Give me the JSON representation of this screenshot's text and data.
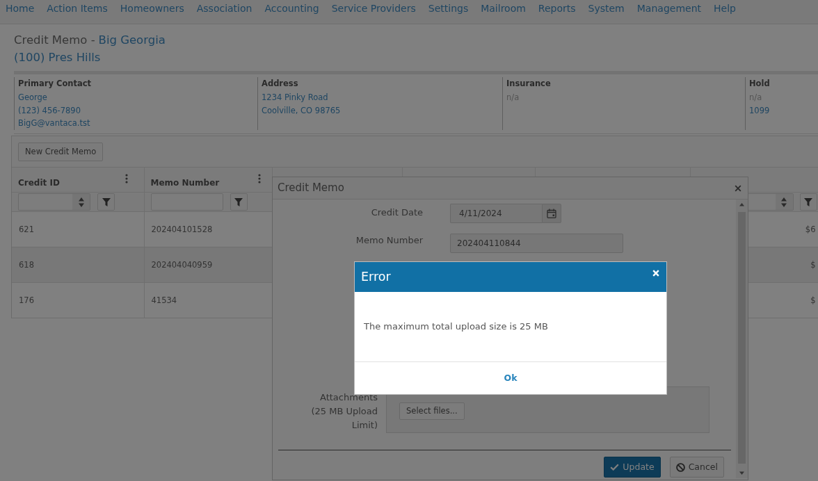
{
  "nav_items": [
    "Home",
    "Action Items",
    "Homeowners",
    "Association",
    "Accounting",
    "Service Providers",
    "Settings",
    "Mailroom",
    "Reports",
    "System",
    "Management",
    "Help"
  ],
  "page_header": {
    "title": "Credit Memo -",
    "homeowner": "Big Georgia",
    "property": "(100) Pres Hills"
  },
  "info_panel": [
    {
      "heading": "Primary Contact",
      "lines": [
        {
          "text": "George",
          "kind": "link"
        },
        {
          "text": "(123) 456-7890",
          "kind": "link"
        },
        {
          "text": "BigG@vantaca.tst",
          "kind": "link"
        }
      ]
    },
    {
      "heading": "Address",
      "lines": [
        {
          "text": "1234 Pinky Road",
          "kind": "link"
        },
        {
          "text": "Coolville, CO 98765",
          "kind": "link"
        }
      ]
    },
    {
      "heading": "Insurance",
      "lines": [
        {
          "text": "n/a",
          "kind": "muted"
        }
      ]
    },
    {
      "heading": "Hold",
      "lines": [
        {
          "text": "n/a",
          "kind": "muted"
        },
        {
          "text": "1099",
          "kind": "link"
        }
      ]
    }
  ],
  "toolbar": {
    "buttons": [
      "New Credit Memo"
    ]
  },
  "grid": {
    "columns": [
      {
        "label": "Credit ID",
        "kind": "numeric"
      },
      {
        "label": "Memo Number",
        "kind": "text"
      }
    ],
    "column_6": {
      "kind": "numeric"
    },
    "rows": [
      {
        "cells": [
          "621",
          "202404101528"
        ],
        "column_6": "$6"
      },
      {
        "cells": [
          "618",
          "202404040959"
        ],
        "column_6": "$"
      },
      {
        "cells": [
          "176",
          "41534"
        ],
        "column_6": "$"
      }
    ]
  },
  "credit_memo_dialog": {
    "title": "Credit Memo",
    "fields": [
      {
        "kind": "date",
        "label": "Credit Date",
        "value": "4/11/2024"
      },
      {
        "kind": "text",
        "label": "Memo Number",
        "value": "202404110844"
      },
      {
        "kind": "upload",
        "label": "Attachments (25 MB Upload Limit)",
        "button": "Select files..."
      }
    ],
    "buttons": [
      {
        "kind": "primary",
        "label": "Update"
      },
      {
        "kind": "cancel",
        "label": "Cancel"
      }
    ]
  },
  "error_dialog": {
    "title": "Error",
    "message": "The maximum total upload size is 25 MB",
    "button": "Ok"
  }
}
